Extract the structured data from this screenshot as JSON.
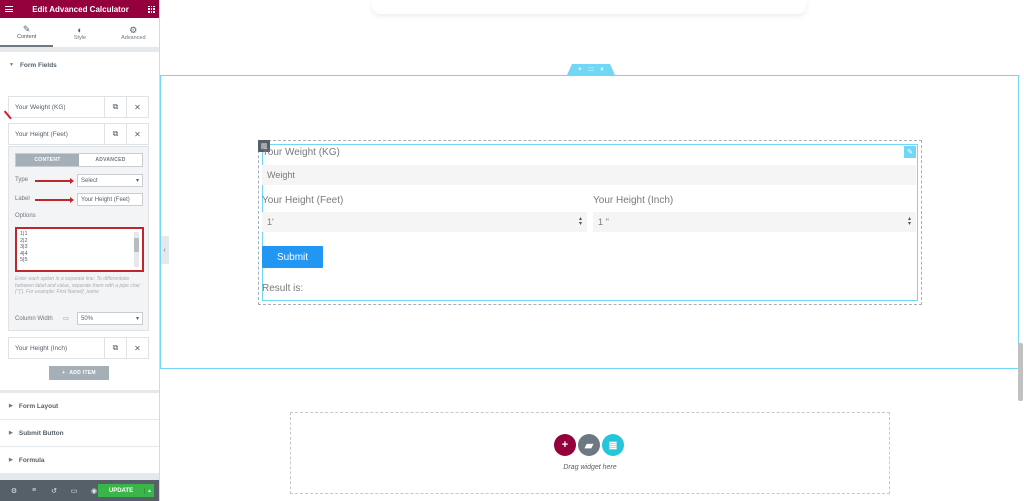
{
  "panel": {
    "title": "Edit Advanced Calculator",
    "tabs": [
      {
        "label": "Content",
        "icon": "pencil-icon"
      },
      {
        "label": "Style",
        "icon": "half-circle-icon"
      },
      {
        "label": "Advanced",
        "icon": "gear-icon"
      }
    ],
    "form_fields_title": "Form Fields",
    "repeater_items": [
      {
        "label": "Your Weight (KG)"
      },
      {
        "label": "Your Height (Feet)"
      },
      {
        "label": "Your Height (Inch)"
      }
    ],
    "editor": {
      "seg_content": "CONTENT",
      "seg_advanced": "ADVANCED",
      "type_label": "Type",
      "type_value": "Select",
      "label_label": "Label",
      "label_value": "Your Height (Feet)",
      "options_label": "Options",
      "options_lines": [
        "1|1",
        "2|2",
        "3|3",
        "4|4",
        "5|5"
      ],
      "options_help": "Enter each option in a separate line. To differentiate between label and value, separate them with a pipe char (\"|\"). For example: First Name|f_name",
      "column_width_label": "Column Width",
      "column_width_value": "50%"
    },
    "add_item": "ADD ITEM",
    "sections": [
      "Form Layout",
      "Submit Button",
      "Formula"
    ],
    "update_label": "UPDATE"
  },
  "preview": {
    "section_handle": {
      "add": "+",
      "move": ":::",
      "close": "×"
    },
    "form": {
      "weight_label": "Your Weight (KG)",
      "weight_placeholder": "Weight",
      "height_feet_label": "Your Height (Feet)",
      "height_feet_value": "1'",
      "height_inch_label": "Your Height (Inch)",
      "height_inch_value": "1 ''",
      "submit_label": "Submit",
      "result_label": "Result is:"
    },
    "drag_text": "Drag widget here"
  },
  "colors": {
    "brand": "#93003c",
    "accent": "#71d7f7",
    "submit": "#2196f3",
    "update": "#39b54a"
  }
}
